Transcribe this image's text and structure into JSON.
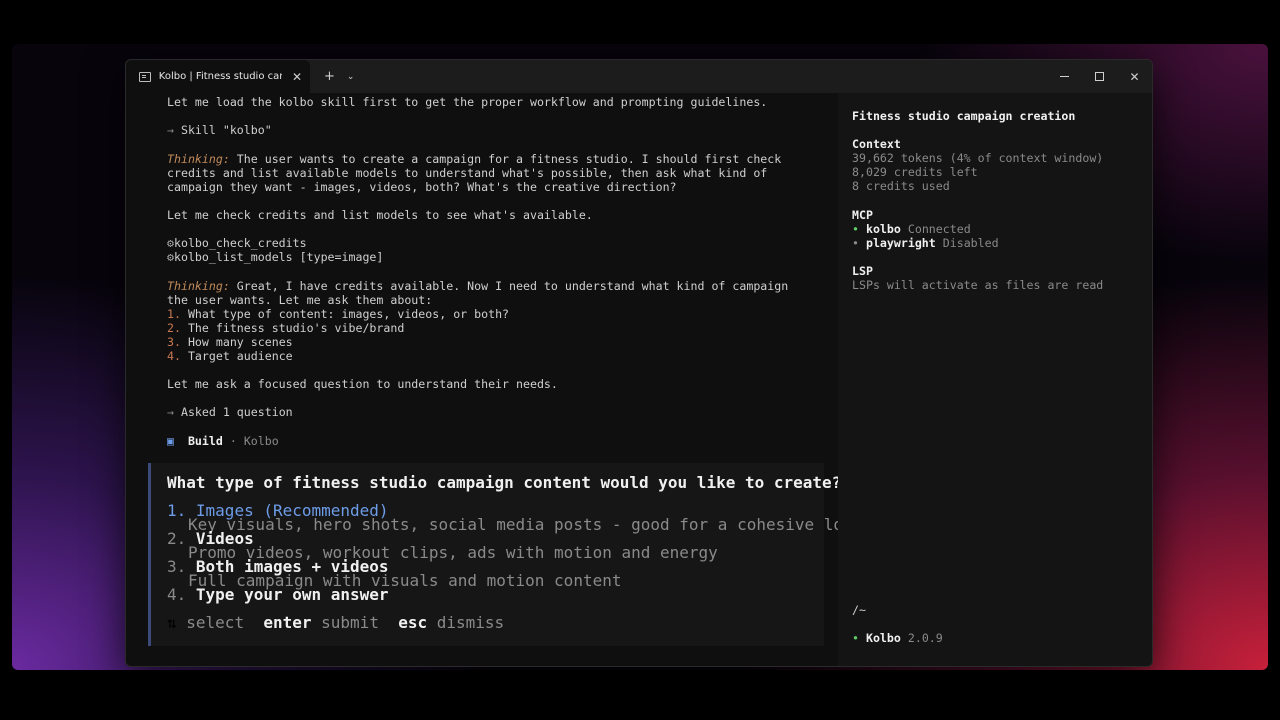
{
  "window": {
    "tab_title": "Kolbo | Fitness studio campaign creation",
    "new_tab_glyph": "+",
    "dropdown_glyph": "⌄",
    "close_glyph": "✕",
    "controls": {
      "minimize": "minimize-icon",
      "maximize": "maximize-icon",
      "close": "✕"
    }
  },
  "transcript": {
    "intro": "Let me load the kolbo skill first to get the proper workflow and prompting guidelines.",
    "skill_arrow": "→",
    "skill_call": "Skill \"kolbo\"",
    "thinking_label": "Thinking:",
    "thinking1_l1": " The user wants to create a campaign for a fitness studio. I should first check",
    "thinking1_l2": "credits and list available models to understand what's possible, then ask what kind of",
    "thinking1_l3": "campaign they want - images, videos, both? What's the creative direction?",
    "check_line": "Let me check credits and list models to see what's available.",
    "tool1": "kolbo_check_credits",
    "tool2": "kolbo_list_models [type=image]",
    "thinking2_l1": " Great, I have credits available. Now I need to understand what kind of campaign",
    "thinking2_l2": "the user wants. Let me ask them about:",
    "list": [
      {
        "num": "1.",
        "text": " What type of content: images, videos, or both?"
      },
      {
        "num": "2.",
        "text": " The fitness studio's vibe/brand"
      },
      {
        "num": "3.",
        "text": " How many scenes"
      },
      {
        "num": "4.",
        "text": " Target audience"
      }
    ],
    "ask_line": "Let me ask a focused question to understand their needs.",
    "asked": "Asked 1 question",
    "build_icon": "▣",
    "build_label": "Build",
    "build_sep": " · ",
    "build_agent": "Kolbo"
  },
  "question": {
    "prompt": "What type of fitness studio campaign content would you like to create?",
    "options": [
      {
        "num": "1.",
        "label": "Images (Recommended)",
        "desc": "Key visuals, hero shots, social media posts - good for a cohesive look"
      },
      {
        "num": "2.",
        "label": "Videos",
        "desc": "Promo videos, workout clips, ads with motion and energy"
      },
      {
        "num": "3.",
        "label": "Both images + videos",
        "desc": "Full campaign with visuals and motion content"
      },
      {
        "num": "4.",
        "label": "Type your own answer",
        "desc": ""
      }
    ],
    "hints": {
      "arrows": "⇅",
      "select": " select",
      "enter": "enter",
      "submit": " submit",
      "esc": "esc",
      "dismiss": " dismiss"
    }
  },
  "sidebar": {
    "title": "Fitness studio campaign creation",
    "context_head": "Context",
    "tokens": "39,662 tokens (4% of context window)",
    "credits_left": "8,029 credits left",
    "credits_used": "8 credits used",
    "mcp_head": "MCP",
    "mcp": [
      {
        "bullet": "•",
        "name": "kolbo",
        "status": " Connected",
        "color": "#5fd16b"
      },
      {
        "bullet": "•",
        "name": "playwright",
        "status": " Disabled",
        "color": "#8a8a8a"
      }
    ],
    "lsp_head": "LSP",
    "lsp_text": "LSPs will activate as files are read",
    "cwd": "/~",
    "version_bullet": "•",
    "app_name": "Kolbo",
    "version": " 2.0.9"
  }
}
